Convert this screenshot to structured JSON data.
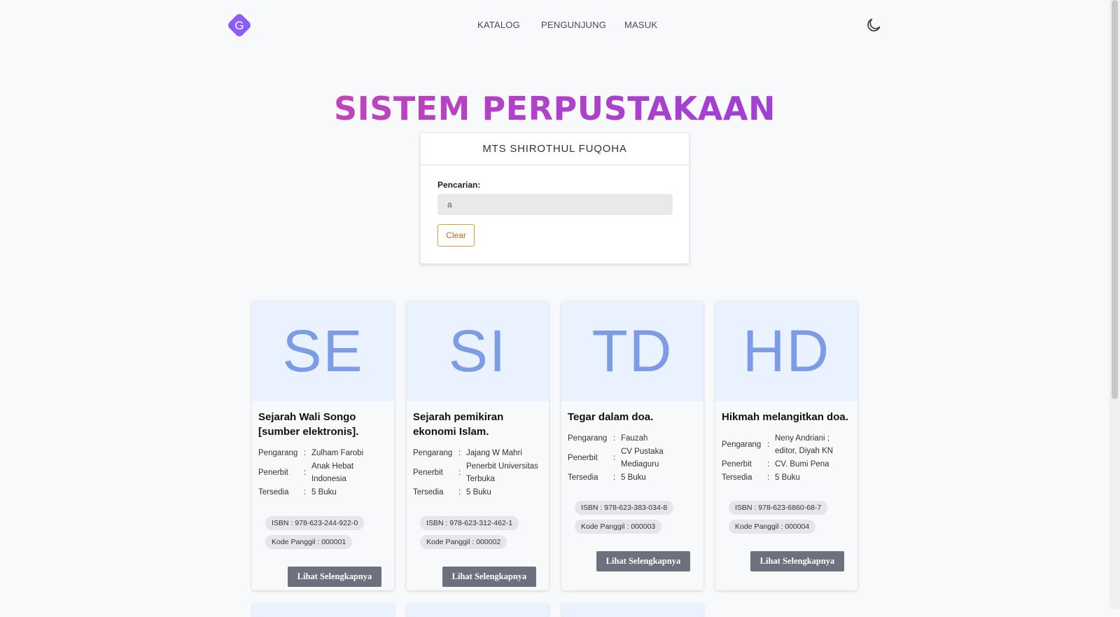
{
  "header": {
    "logo_letter": "G",
    "nav": [
      "KATALOG",
      "PENGUNJUNG",
      "MASUK"
    ],
    "theme_icon": "moon-icon"
  },
  "hero": {
    "title": "SISTEM PERPUSTAKAAN",
    "school": "MTS SHIROTHUL FUQOHA",
    "search_label": "Pencarian:",
    "search_value": "a",
    "clear_label": "Clear"
  },
  "labels": {
    "pengarang": "Pengarang",
    "penerbit": "Penerbit",
    "tersedia": "Tersedia",
    "colon": ":",
    "more": "Lihat Selengkapnya"
  },
  "books": [
    {
      "initials": "SE",
      "title": "Sejarah Wali Songo [sumber elektronis].",
      "pengarang": "Zulham Farobi",
      "penerbit": "Anak Hebat Indonesia",
      "tersedia": "5 Buku",
      "isbn": "ISBN : 978-623-244-922-0",
      "kode": "Kode Panggil : 000001"
    },
    {
      "initials": "SI",
      "title": "Sejarah pemikiran ekonomi Islam.",
      "pengarang": "Jajang W Mahri",
      "penerbit": "Penerbit Universitas Terbuka",
      "tersedia": "5 Buku",
      "isbn": "ISBN : 978-623-312-462-1",
      "kode": "Kode Panggil : 000002"
    },
    {
      "initials": "TD",
      "title": "Tegar dalam doa.",
      "pengarang": "Fauzah",
      "penerbit": "CV Pustaka Mediaguru",
      "tersedia": "5 Buku",
      "isbn": "ISBN : 978-623-383-034-8",
      "kode": "Kode Panggil : 000003"
    },
    {
      "initials": "HD",
      "title": "Hikmah melangitkan doa.",
      "pengarang": "Neny Andriani ; editor, Diyah KN",
      "penerbit": "CV. Bumi Pena",
      "tersedia": "5 Buku",
      "isbn": "ISBN : 978-623-6860-68-7",
      "kode": "Kode Panggil : 000004"
    }
  ]
}
